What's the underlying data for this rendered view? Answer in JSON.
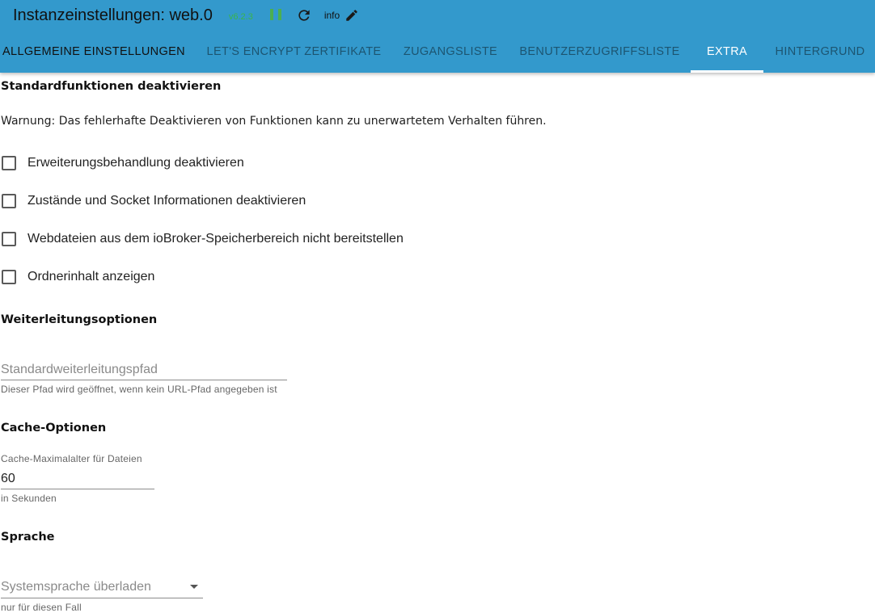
{
  "header": {
    "title": "Instanzeinstellungen: web.0",
    "version": "v6.2.3",
    "info_label": "info",
    "icons": [
      "pause-icon",
      "reload-icon",
      "edit-icon"
    ],
    "colors": {
      "header_bg": "#3399cc",
      "version": "#39b54a",
      "pause": "#4caf50"
    }
  },
  "tabs": [
    {
      "label": "ALLGEMEINE EINSTELLUNGEN",
      "active": false
    },
    {
      "label": "LET'S ENCRYPT ZERTIFIKATE",
      "active": false
    },
    {
      "label": "ZUGANGSLISTE",
      "active": false
    },
    {
      "label": "BENUTZERZUGRIFFSLISTE",
      "active": false
    },
    {
      "label": "EXTRA",
      "active": true
    },
    {
      "label": "HINTERGRUND",
      "active": false
    }
  ],
  "extra": {
    "disable_section": {
      "heading": "Standardfunktionen deaktivieren",
      "warning": "Warnung: Das fehlerhafte Deaktivieren von Funktionen kann zu unerwartetem Verhalten führen.",
      "options": [
        {
          "label": "Erweiterungsbehandlung deaktivieren",
          "checked": false
        },
        {
          "label": "Zustände und Socket Informationen deaktivieren",
          "checked": false
        },
        {
          "label": "Webdateien aus dem ioBroker-Speicherbereich nicht bereitstellen",
          "checked": false
        },
        {
          "label": "Ordnerinhalt anzeigen",
          "checked": false
        }
      ]
    },
    "redirect_section": {
      "heading": "Weiterleitungsoptionen",
      "default_path": {
        "placeholder": "Standardweiterleitungspfad",
        "value": "",
        "helper": "Dieser Pfad wird geöffnet, wenn kein URL-Pfad angegeben ist"
      }
    },
    "cache_section": {
      "heading": "Cache-Optionen",
      "max_age": {
        "label": "Cache-Maximalalter für Dateien",
        "value": "60",
        "helper": "in Sekunden"
      }
    },
    "language_section": {
      "heading": "Sprache",
      "language_select": {
        "placeholder": "Systemsprache überladen",
        "value": "",
        "helper": "nur für diesen Fall"
      }
    }
  }
}
